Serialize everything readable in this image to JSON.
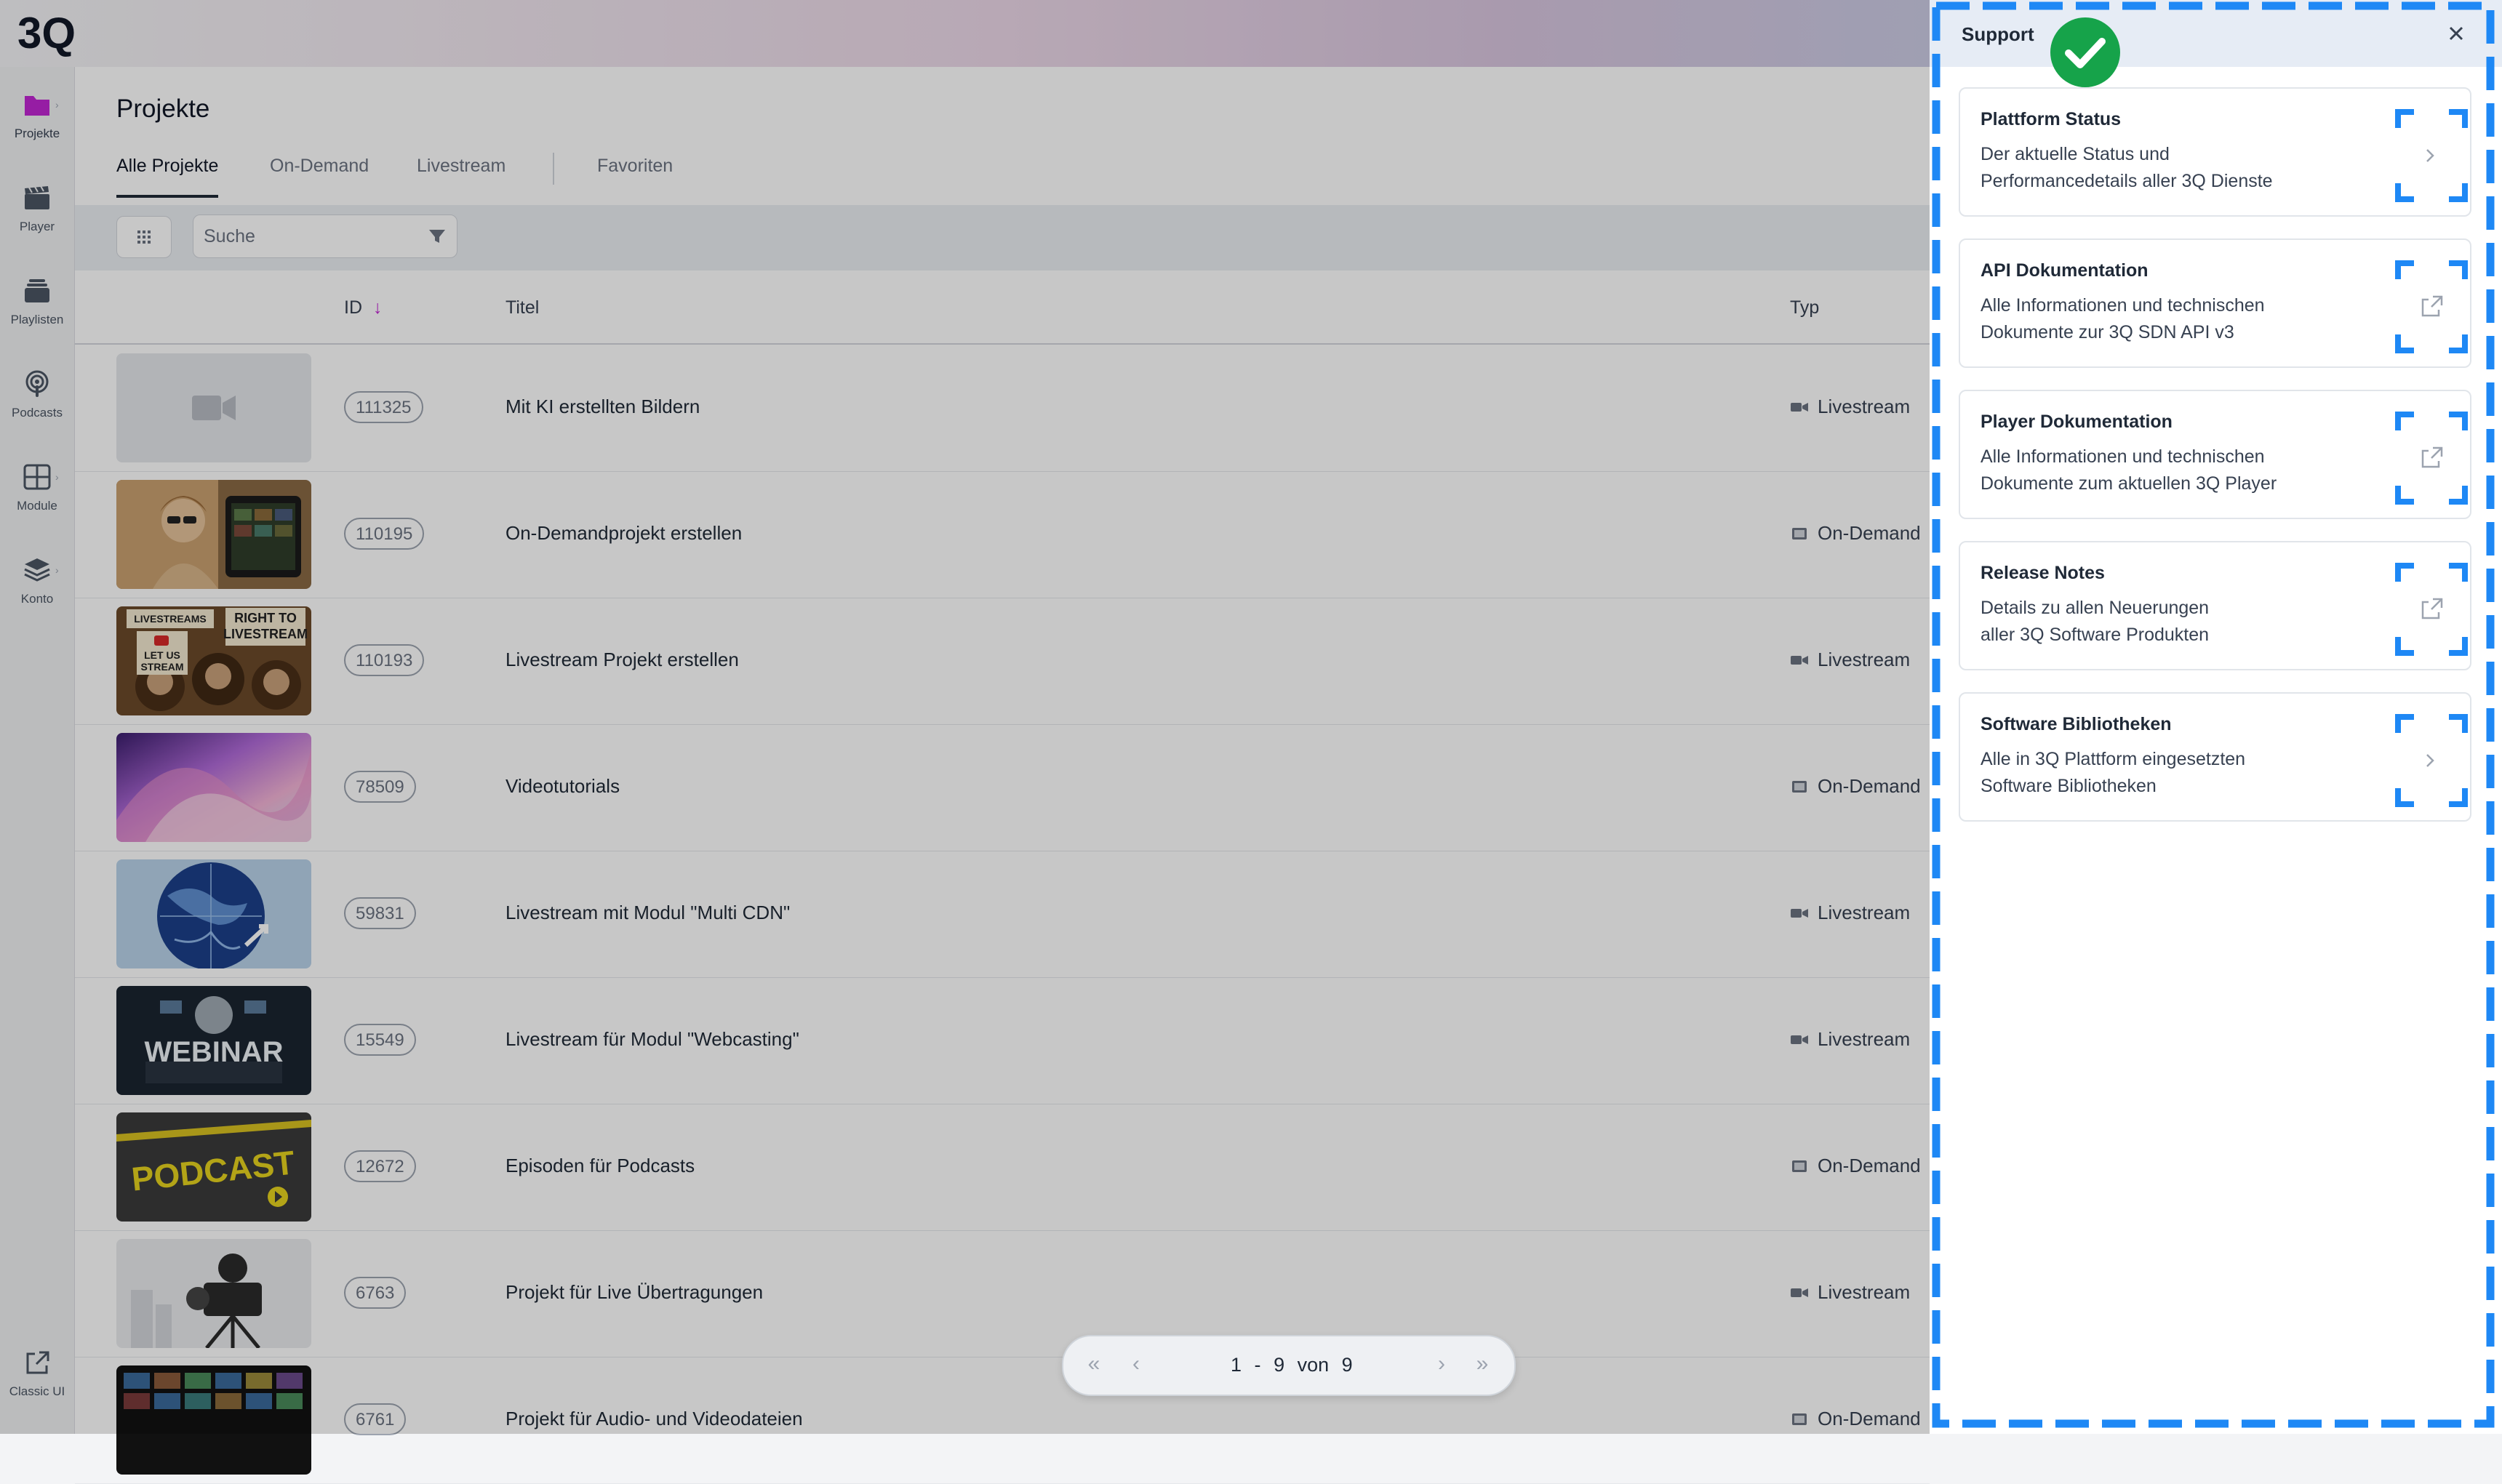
{
  "app": {
    "logo_text": "3Q"
  },
  "sidebar": {
    "items": [
      {
        "label": "Projekte",
        "icon": "folder-icon"
      },
      {
        "label": "Player",
        "icon": "clapperboard-icon"
      },
      {
        "label": "Playlisten",
        "icon": "layers-icon"
      },
      {
        "label": "Podcasts",
        "icon": "podcast-icon"
      },
      {
        "label": "Module",
        "icon": "grid-icon"
      },
      {
        "label": "Konto",
        "icon": "stack-icon"
      }
    ],
    "classic": {
      "label": "Classic UI",
      "icon": "external-link-icon"
    }
  },
  "main": {
    "title": "Projekte",
    "tabs": [
      {
        "label": "Alle Projekte",
        "active": true
      },
      {
        "label": "On-Demand"
      },
      {
        "label": "Livestream"
      },
      {
        "label": "Favoriten"
      }
    ],
    "search": {
      "placeholder": "Suche"
    },
    "table": {
      "columns": {
        "id": "ID",
        "id_sort": "↓",
        "title": "Titel",
        "type": "Typ"
      },
      "rows": [
        {
          "id": "111325",
          "title": "Mit KI erstellten Bildern",
          "type": "Livestream",
          "thumb": "placeholder-camera"
        },
        {
          "id": "110195",
          "title": "On-Demandprojekt erstellen",
          "type": "On-Demand",
          "thumb": "woman-tablet"
        },
        {
          "id": "110193",
          "title": "Livestream Projekt erstellen",
          "type": "Livestream",
          "thumb": "monkeys-signs",
          "thumb_text": [
            "LIVESTREAMS",
            "RIGHT TO",
            "LIVESTREAM",
            "LET US",
            "STREAM"
          ]
        },
        {
          "id": "78509",
          "title": "Videotutorials",
          "type": "On-Demand",
          "thumb": "abstract-wave"
        },
        {
          "id": "59831",
          "title": "Livestream mit Modul \"Multi CDN\"",
          "type": "Livestream",
          "thumb": "globe-network"
        },
        {
          "id": "15549",
          "title": "Livestream für Modul \"Webcasting\"",
          "type": "Livestream",
          "thumb": "webinar",
          "thumb_text": "WEBINAR"
        },
        {
          "id": "12672",
          "title": "Episoden für Podcasts",
          "type": "On-Demand",
          "thumb": "podcast",
          "thumb_text": "PODCAST"
        },
        {
          "id": "6763",
          "title": "Projekt für Live Übertragungen",
          "type": "Livestream",
          "thumb": "camera-rig"
        },
        {
          "id": "6761",
          "title": "Projekt für Audio- und Videodateien",
          "type": "On-Demand",
          "thumb": "video-wall"
        }
      ]
    },
    "pagination": {
      "from": "1",
      "dash": "-",
      "to": "9",
      "of": "von",
      "total": "9"
    }
  },
  "support": {
    "title": "Support",
    "cards": [
      {
        "title": "Plattform Status",
        "desc": [
          "Der aktuelle Status und",
          "Performancedetails aller 3Q Dienste"
        ],
        "icon": "chevron-right-icon"
      },
      {
        "title": "API Dokumentation",
        "desc": [
          "Alle Informationen und technischen",
          "Dokumente zur 3Q SDN API v3"
        ],
        "icon": "external-link-icon"
      },
      {
        "title": "Player Dokumentation",
        "desc": [
          "Alle Informationen und technischen",
          "Dokumente zum aktuellen 3Q Player"
        ],
        "icon": "external-link-icon"
      },
      {
        "title": "Release Notes",
        "desc": [
          "Details zu allen Neuerungen",
          "aller 3Q Software Produkten"
        ],
        "icon": "external-link-icon"
      },
      {
        "title": "Software Bibliotheken",
        "desc": [
          "Alle in 3Q Plattform eingesetzten",
          "Software Bibliotheken"
        ],
        "icon": "chevron-right-icon"
      }
    ]
  },
  "colors": {
    "accent": "#c026d3",
    "highlight": "#1e88f5",
    "success": "#16a34a"
  }
}
